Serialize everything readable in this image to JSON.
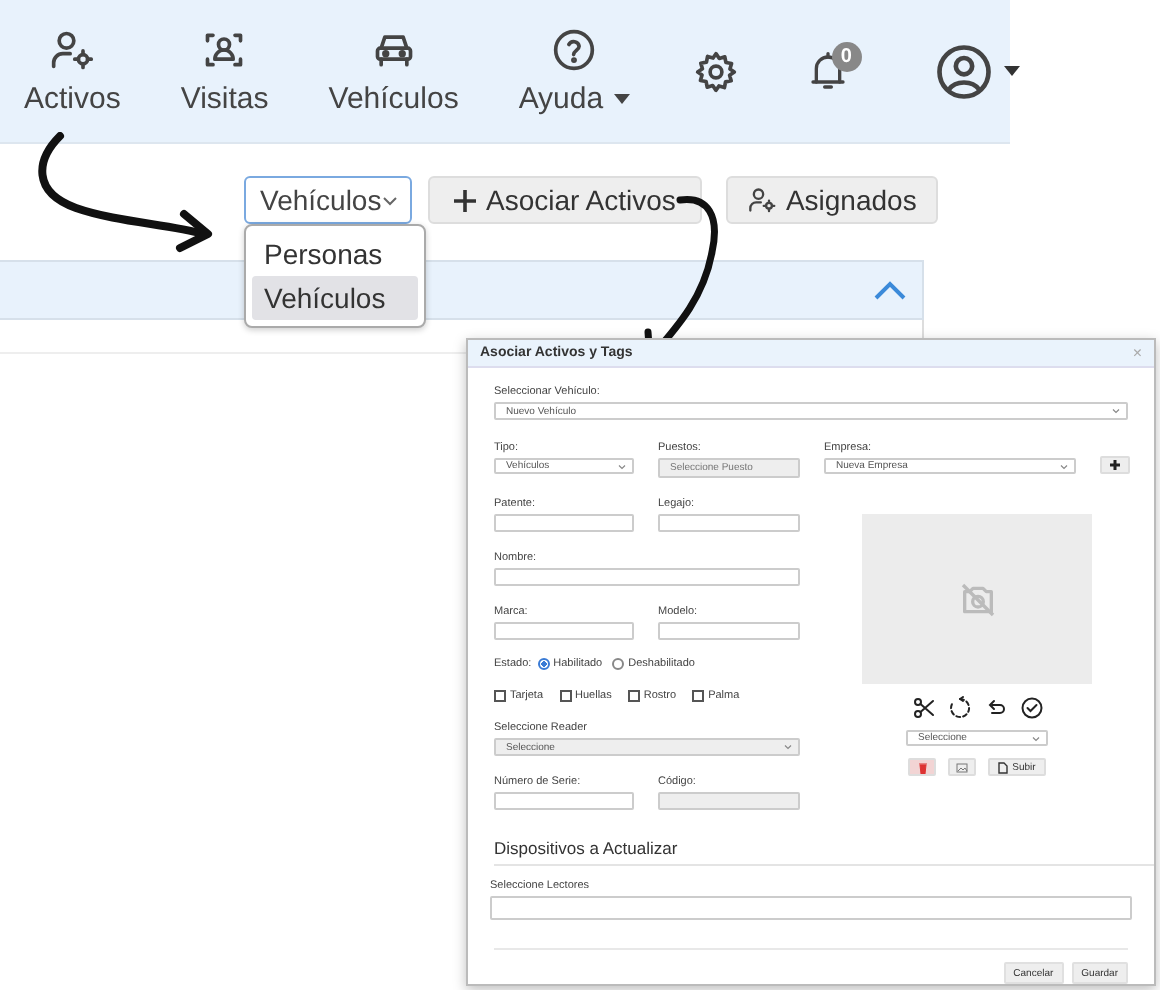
{
  "nav": {
    "items": [
      {
        "label": "Activos",
        "kind": "link"
      },
      {
        "label": "Visitas",
        "kind": "link"
      },
      {
        "label": "Vehículos",
        "kind": "link"
      },
      {
        "label": "Ayuda",
        "kind": "menu"
      }
    ],
    "notifications": "0"
  },
  "toolbar": {
    "select": {
      "value": "Vehículos",
      "options": [
        {
          "label": "Personas",
          "selected": false
        },
        {
          "label": "Vehículos",
          "selected": true
        }
      ]
    },
    "buttons": [
      "Asociar Activos",
      "Asignados"
    ]
  },
  "dialog": {
    "title": "Asociar Activos y Tags",
    "close": "×",
    "vehicle": {
      "label": "Seleccionar Vehículo:",
      "value": "Nuevo Vehículo"
    },
    "tipo": {
      "label": "Tipo:",
      "value": "Vehículos"
    },
    "puestos": {
      "label": "Puestos:",
      "placeholder": "Seleccione Puesto",
      "disabled": true
    },
    "empresa": {
      "label": "Empresa:",
      "value": "Nueva Empresa"
    },
    "patente": {
      "label": "Patente:"
    },
    "legajo": {
      "label": "Legajo:"
    },
    "nombre": {
      "label": "Nombre:"
    },
    "marca": {
      "label": "Marca:"
    },
    "modelo": {
      "label": "Modelo:"
    },
    "estado": {
      "label": "Estado:",
      "options": [
        {
          "label": "Habilitado",
          "selected": true
        },
        {
          "label": "Deshabilitado",
          "selected": false
        }
      ]
    },
    "biometrics": [
      {
        "label": "Tarjeta",
        "checked": false
      },
      {
        "label": "Huellas",
        "checked": false
      },
      {
        "label": "Rostro",
        "checked": false
      },
      {
        "label": "Palma",
        "checked": false
      }
    ],
    "reader": {
      "label": "Seleccione Reader",
      "value": "Seleccione",
      "disabled": true
    },
    "serie": {
      "label": "Número de Serie:"
    },
    "codigo": {
      "label": "Código:",
      "disabled": true
    },
    "photo_select": {
      "value": "Seleccione"
    },
    "upload_button": "Subir",
    "devices": {
      "heading": "Dispositivos a Actualizar",
      "label": "Seleccione Lectores"
    },
    "buttons": [
      "Cancelar",
      "Guardar"
    ]
  }
}
